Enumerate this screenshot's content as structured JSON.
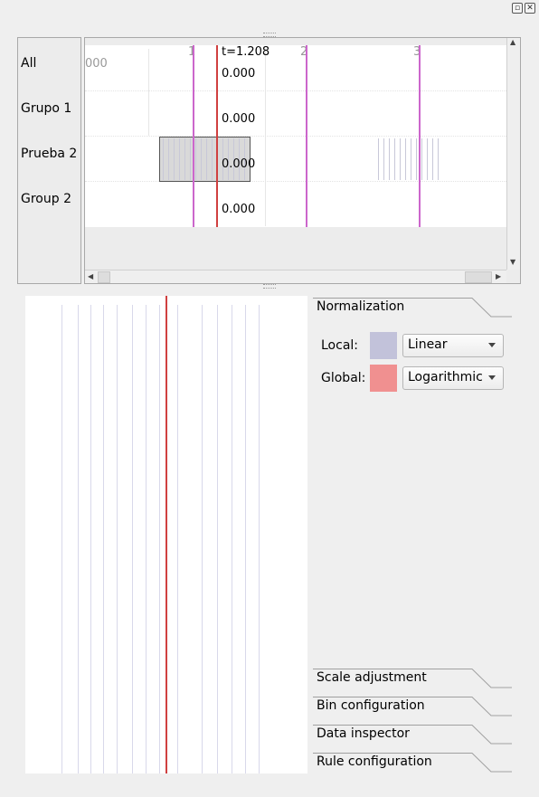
{
  "timeline": {
    "row_labels": [
      "All",
      "Grupo 1",
      "Prueba 2",
      "Group 2"
    ],
    "tick_prefix": "000",
    "ticks": [
      "1",
      "2",
      "3"
    ],
    "cursor_label": "t=1.208",
    "row_values": [
      "0.000",
      "0.000",
      "0.000",
      "0.000"
    ]
  },
  "normalization": {
    "title": "Normalization",
    "local_label": "Local:",
    "local_mode": "Linear",
    "global_label": "Global:",
    "global_mode": "Logarithmic"
  },
  "sections": {
    "scale_adjustment": "Scale adjustment",
    "bin_configuration": "Bin configuration",
    "data_inspector": "Data inspector",
    "rule_configuration": "Rule configuration"
  },
  "colors": {
    "local": "#c2c2da",
    "global": "#f09090",
    "marker_magenta": "#cc66cc",
    "marker_red": "#d04040"
  }
}
